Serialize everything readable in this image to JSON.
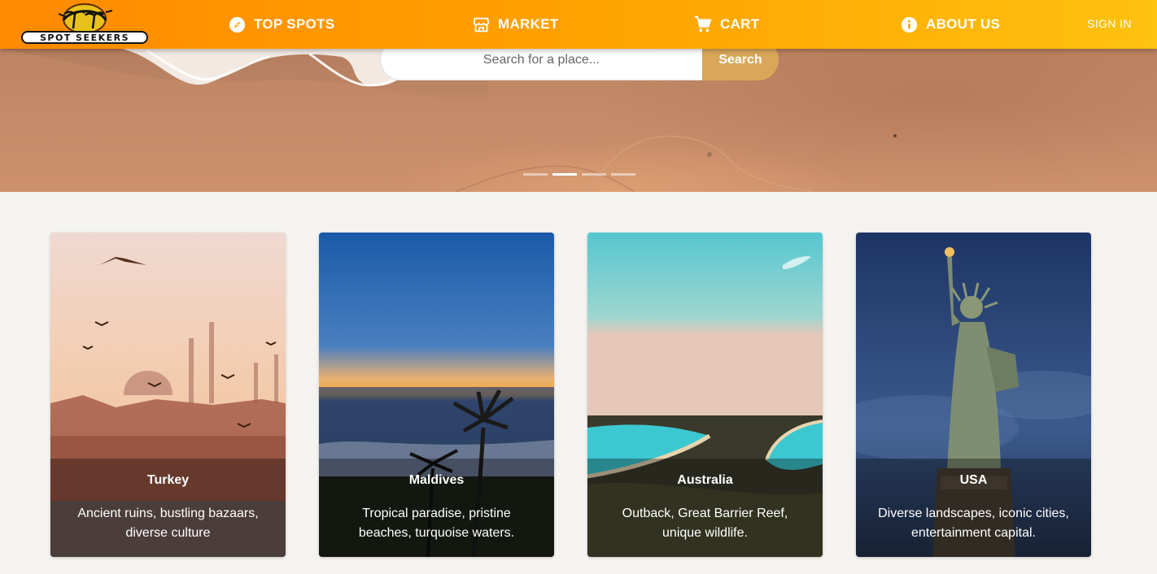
{
  "brand": {
    "name": "SPOT SEEKERS"
  },
  "nav": {
    "items": [
      {
        "label": "TOP SPOTS",
        "icon": "compass-icon"
      },
      {
        "label": "MARKET",
        "icon": "store-icon"
      },
      {
        "label": "CART",
        "icon": "cart-icon"
      },
      {
        "label": "ABOUT US",
        "icon": "info-icon"
      }
    ],
    "signin_label": "SIGN IN"
  },
  "hero": {
    "search_placeholder": "Search for a place...",
    "search_button_label": "Search",
    "carousel": {
      "slide_count": 4,
      "active_index": 1
    }
  },
  "destinations": [
    {
      "name": "Turkey",
      "description": "Ancient ruins, bustling bazaars, diverse culture"
    },
    {
      "name": "Maldives",
      "description": "Tropical paradise, pristine beaches, turquoise waters."
    },
    {
      "name": "Australia",
      "description": "Outback, Great Barrier Reef, unique wildlife."
    },
    {
      "name": "USA",
      "description": "Diverse landscapes, iconic cities, entertainment capital."
    }
  ],
  "colors": {
    "nav_gradient_start": "#ff8a00",
    "nav_gradient_end": "#ffc20e",
    "search_button": "#d9a75a",
    "page_background": "#f4f3f0"
  }
}
